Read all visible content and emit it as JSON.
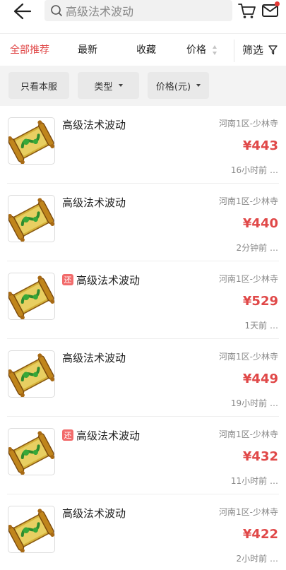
{
  "search": {
    "placeholder": "高级法术波动"
  },
  "tabs": {
    "recommend": "全部推荐",
    "latest": "最新",
    "favorites": "收藏",
    "price": "价格",
    "filter": "筛选"
  },
  "chips": {
    "server_only": "只看本服",
    "type": "类型",
    "price_unit": "价格(元)"
  },
  "items": [
    {
      "title": "高级法术波动",
      "tag": "",
      "server": "河南1区-少林寺",
      "price": "¥443",
      "time": "16小时前 …"
    },
    {
      "title": "高级法术波动",
      "tag": "",
      "server": "河南1区-少林寺",
      "price": "¥440",
      "time": "2分钟前 …"
    },
    {
      "title": "高级法术波动",
      "tag": "还",
      "server": "河南1区-少林寺",
      "price": "¥529",
      "time": "1天前 …"
    },
    {
      "title": "高级法术波动",
      "tag": "",
      "server": "河南1区-少林寺",
      "price": "¥449",
      "time": "19小时前 …"
    },
    {
      "title": "高级法术波动",
      "tag": "还",
      "server": "河南1区-少林寺",
      "price": "¥432",
      "time": "11小时前 …"
    },
    {
      "title": "高级法术波动",
      "tag": "",
      "server": "河南1区-少林寺",
      "price": "¥422",
      "time": "2小时前 …"
    }
  ],
  "icons": {
    "back": "back-arrow-icon",
    "search": "search-icon",
    "cart": "cart-icon",
    "mail": "mail-icon",
    "filter": "funnel-icon",
    "thumb": "scroll-item-icon"
  },
  "colors": {
    "accent": "#e04848",
    "tag": "#f26b6b",
    "notify": "#e53935"
  }
}
